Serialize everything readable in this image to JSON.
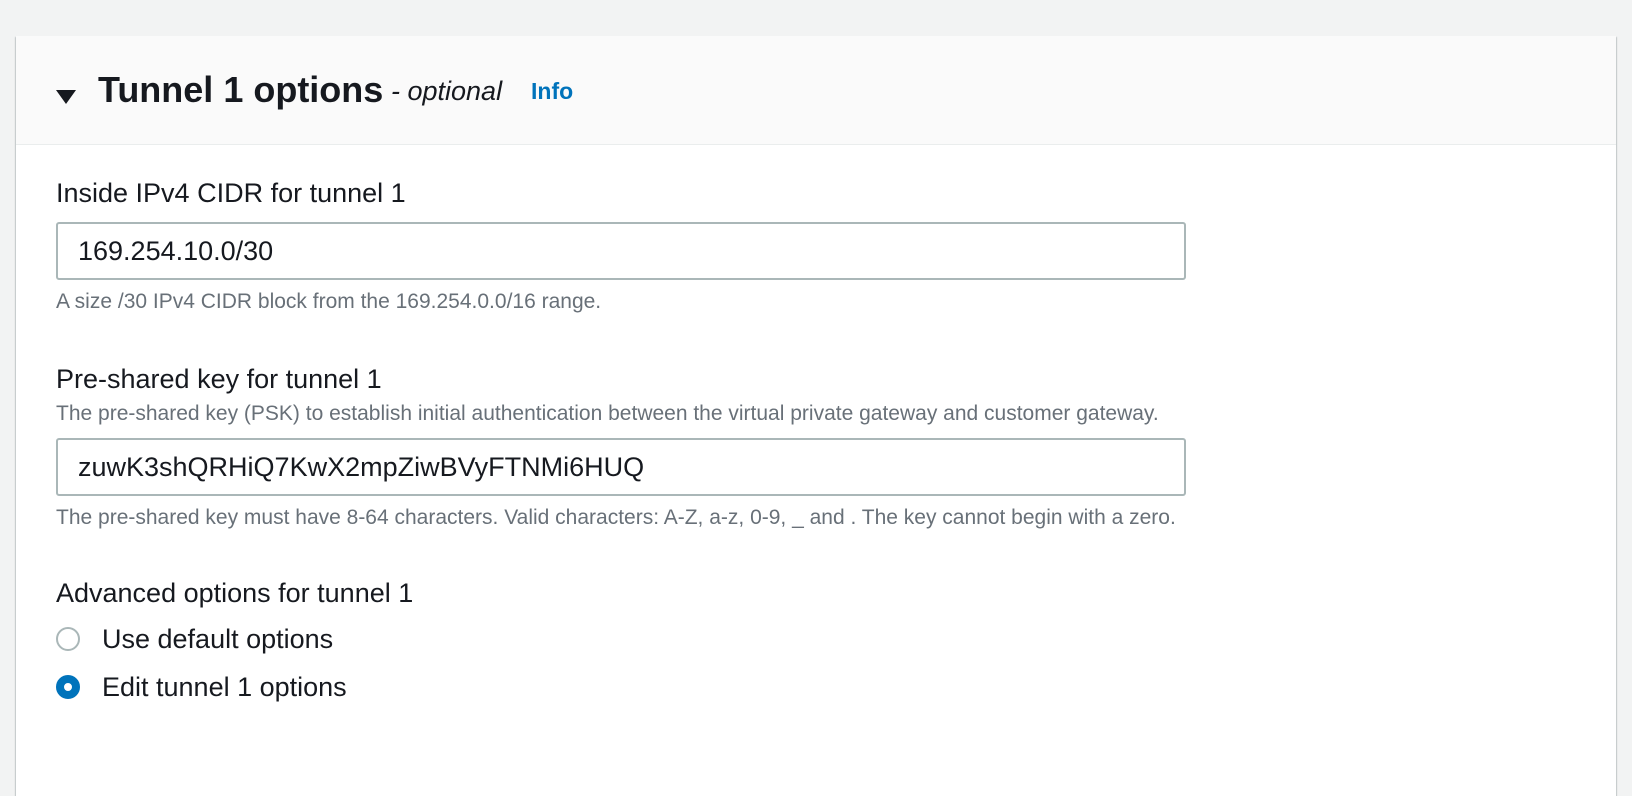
{
  "section": {
    "title": "Tunnel 1 options",
    "optional_suffix": "- optional",
    "info_link": "Info",
    "caret_icon": "caret-down-icon"
  },
  "inside_cidr": {
    "label": "Inside IPv4 CIDR for tunnel 1",
    "value": "169.254.10.0/30",
    "hint": "A size /30 IPv4 CIDR block from the 169.254.0.0/16 range."
  },
  "psk": {
    "label": "Pre-shared key for tunnel 1",
    "description": "The pre-shared key (PSK) to establish initial authentication between the virtual private gateway and customer gateway.",
    "value": "zuwK3shQRHiQ7KwX2mpZiwBVyFTNMi6HUQ",
    "hint": "The pre-shared key must have 8-64 characters. Valid characters: A-Z, a-z, 0-9, _ and . The key cannot begin with a zero."
  },
  "advanced": {
    "label": "Advanced options for tunnel 1",
    "options": [
      {
        "label": "Use default options",
        "selected": false
      },
      {
        "label": "Edit tunnel 1 options",
        "selected": true
      }
    ]
  },
  "colors": {
    "accent": "#0073bb",
    "text": "#16191f",
    "muted": "#687078",
    "border": "#aab7b8",
    "header_bg": "#fafafa",
    "page_bg": "#f2f3f3"
  }
}
